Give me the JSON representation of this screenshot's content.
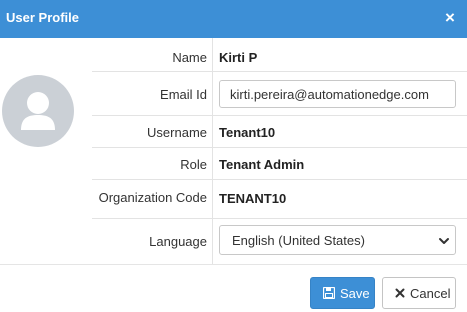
{
  "dialog": {
    "title": "User Profile",
    "close_glyph": "×"
  },
  "profile": {
    "fields": {
      "name": {
        "label": "Name",
        "value": "Kirti P"
      },
      "email": {
        "label": "Email Id",
        "value": "kirti.pereira@automationedge.com"
      },
      "username": {
        "label": "Username",
        "value": "Tenant10"
      },
      "role": {
        "label": "Role",
        "value": "Tenant Admin"
      },
      "org_code": {
        "label": "Organization Code",
        "value": "TENANT10"
      },
      "language": {
        "label": "Language",
        "selected": "English (United States)"
      }
    }
  },
  "footer": {
    "save_label": "Save",
    "cancel_label": "Cancel"
  },
  "icons": {
    "close": "close-icon",
    "avatar": "user-silhouette-icon",
    "save": "floppy-disk-icon",
    "cancel": "x-icon",
    "select": "chevron-down-icon"
  },
  "colors": {
    "header": "#3d8fd6",
    "primary_button": "#3d8fd6",
    "avatar_bg": "#cbd0d6"
  }
}
